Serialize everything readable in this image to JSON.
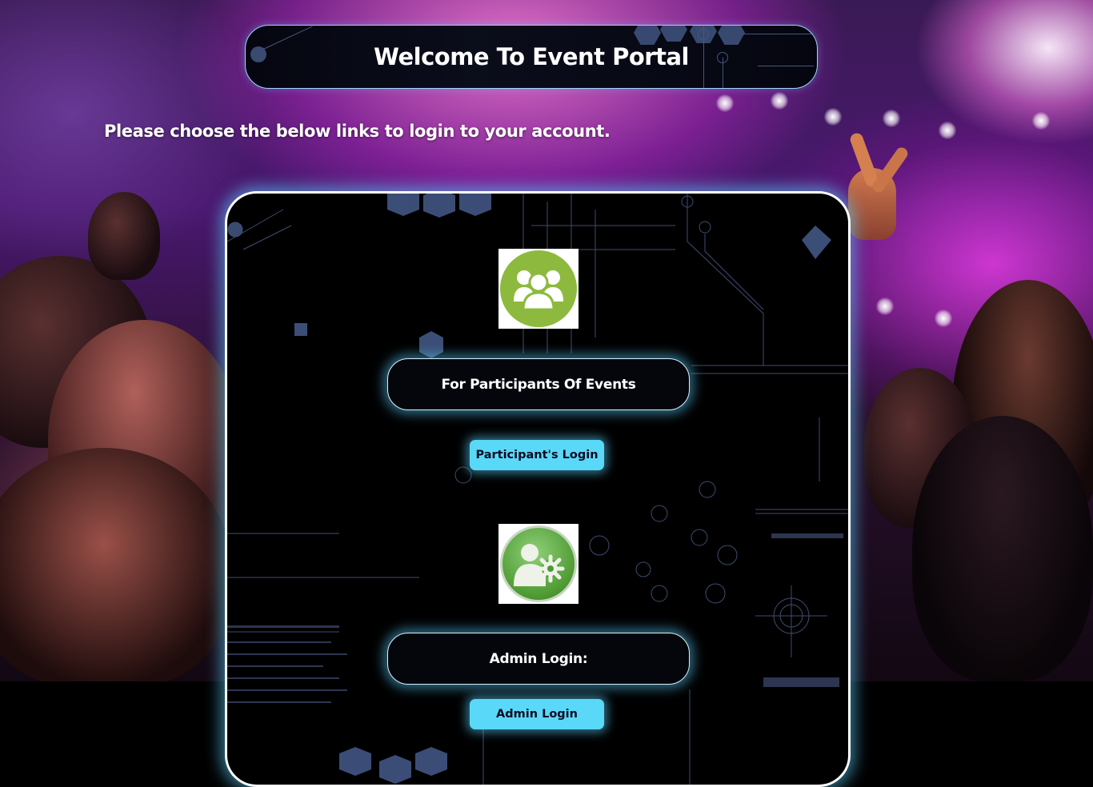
{
  "header": {
    "title": "Welcome To Event Portal"
  },
  "intro": {
    "text": "Please choose the below links to login to your account."
  },
  "participants": {
    "icon": "group-people-icon",
    "heading": "For Participants Of Events",
    "button_label": "Participant's Login"
  },
  "admin": {
    "icon": "admin-user-gear-icon",
    "heading": "Admin Login:",
    "button_label": "Admin Login"
  },
  "colors": {
    "accent": "#5ad8f8",
    "glow": "#5ad2ff",
    "icon_green": "#8dba3e",
    "panel_bg": "#000000"
  }
}
